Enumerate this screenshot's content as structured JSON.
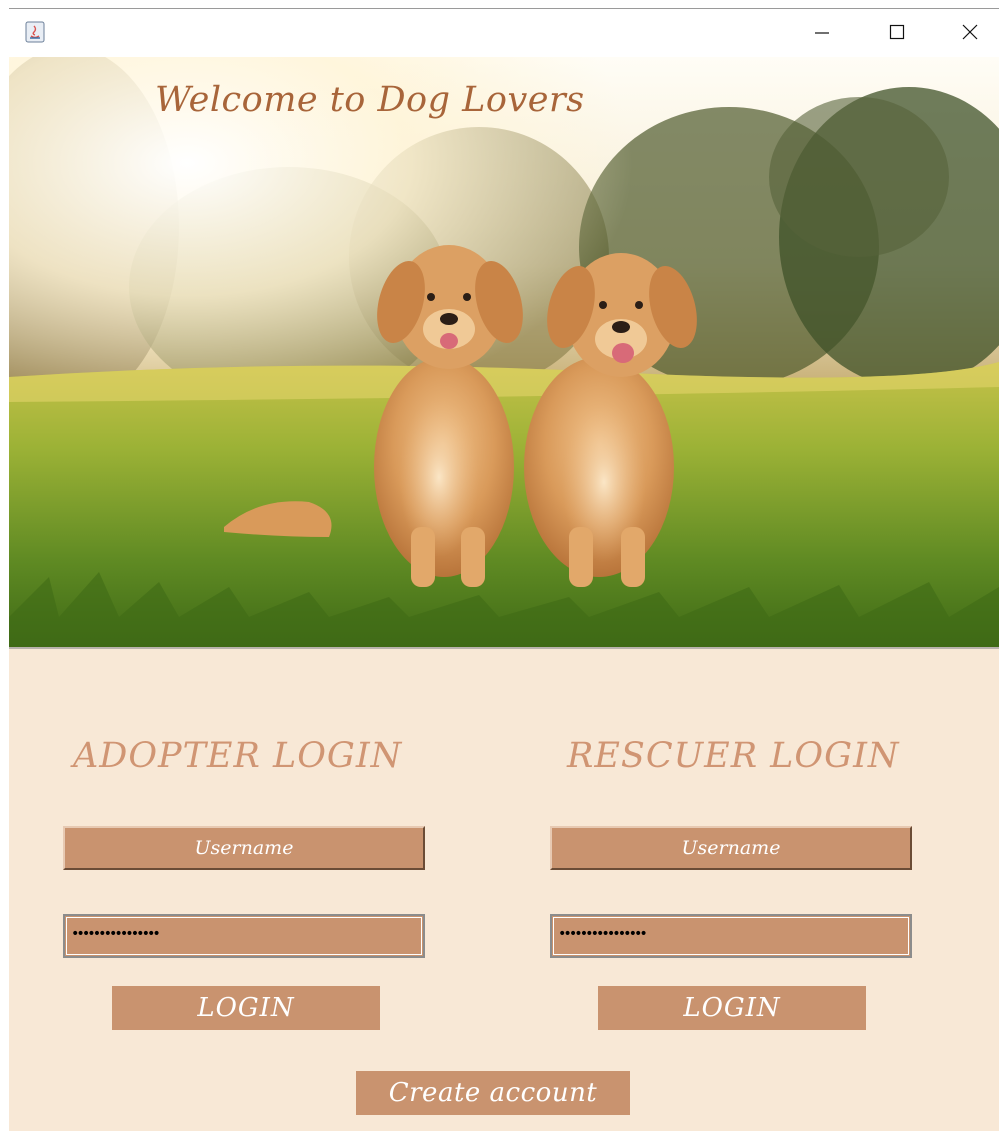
{
  "window": {
    "title": "",
    "controls": {
      "minimize_icon": "minimize-icon",
      "maximize_icon": "maximize-icon",
      "close_icon": "close-icon"
    }
  },
  "hero": {
    "welcome_text": "Welcome to Dog Lovers",
    "image": "two golden retrievers sitting on grass"
  },
  "adopter": {
    "title": "ADOPTER LOGIN",
    "username_label": "Username",
    "password_value": "••••••••••••••••",
    "login_label": "LOGIN"
  },
  "rescuer": {
    "title": "RESCUER LOGIN",
    "username_label": "Username",
    "password_value": "••••••••••••••••",
    "login_label": "LOGIN"
  },
  "create_account_label": "Create account",
  "colors": {
    "panel_background": "#f8e8d6",
    "field_background": "#c9936f",
    "title_color": "#d09573",
    "welcome_color": "#a8653a"
  }
}
